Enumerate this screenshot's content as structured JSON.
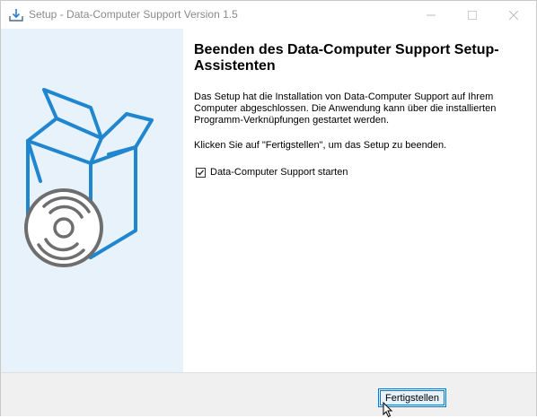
{
  "window": {
    "title": "Setup - Data-Computer Support Version 1.5"
  },
  "icons": {
    "app": "installer-icon",
    "minimize": "minimize-icon",
    "maximize": "maximize-icon",
    "close": "close-icon",
    "sidebar_art": "box-disc-icon",
    "checkmark": "checkmark-icon",
    "cursor": "mouse-cursor-icon"
  },
  "content": {
    "heading": "Beenden des Data-Computer Support Setup-Assistenten",
    "paragraph1": "Das Setup hat die Installation von Data-Computer Support auf Ihrem Computer abgeschlossen. Die Anwendung kann über die installierten Programm-Verknüpfungen gestartet werden.",
    "paragraph2": "Klicken Sie auf \"Fertigstellen\", um das Setup zu beenden.",
    "launch_checkbox": {
      "label": "Data-Computer Support starten",
      "checked": true
    }
  },
  "footer": {
    "finish_label": "Fertigstellen"
  },
  "colors": {
    "sidebar_bg": "#e8f2fa",
    "accent_blue": "#1f86cf",
    "disc_gray": "#6e6e6e",
    "button_border": "#0078d7"
  }
}
